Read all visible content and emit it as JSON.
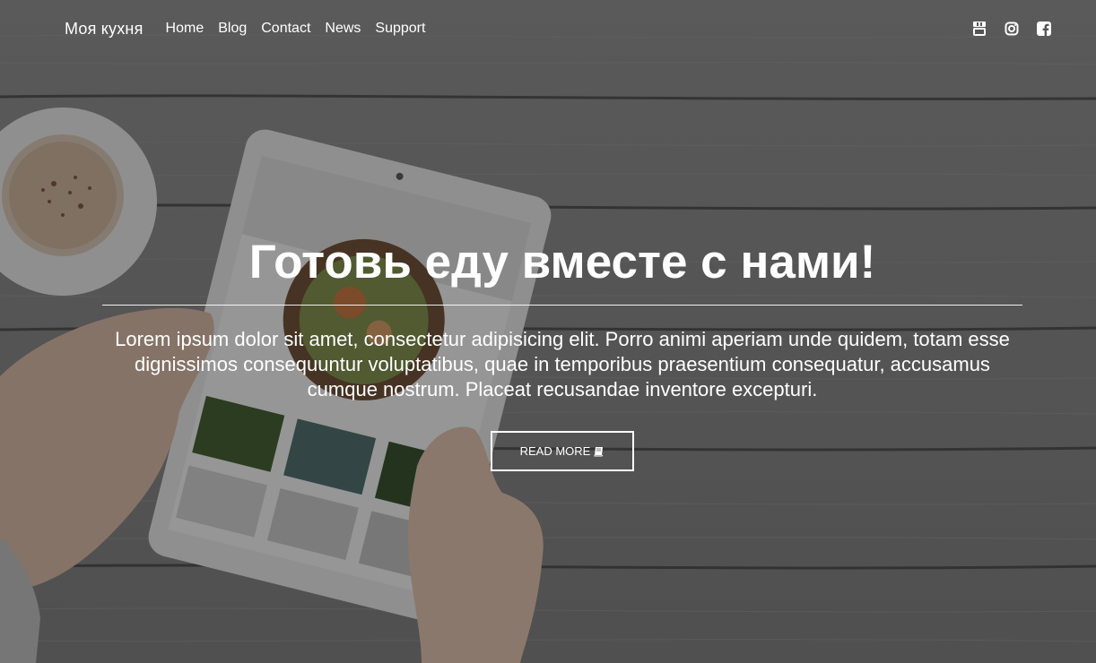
{
  "navbar": {
    "brand": "Моя кухня",
    "links": [
      {
        "label": "Home"
      },
      {
        "label": "Blog"
      },
      {
        "label": "Contact"
      },
      {
        "label": "News"
      },
      {
        "label": "Support"
      }
    ],
    "social": [
      "youtube-icon",
      "instagram-icon",
      "facebook-icon"
    ]
  },
  "hero": {
    "title": "Готовь еду вместе с нами!",
    "lead": "Lorem ipsum dolor sit amet, consectetur adipisicing elit. Porro animi aperiam unde quidem, totam esse dignissimos consequuntur voluptatibus, quae in temporibus praesentium consequatur, accusamus cumque nostrum. Placeat recusandae inventore excepturi.",
    "button_label": "READ MORE",
    "button_icon": "book-icon"
  },
  "colors": {
    "text": "#ffffff",
    "overlay": "#1a1a1a"
  }
}
